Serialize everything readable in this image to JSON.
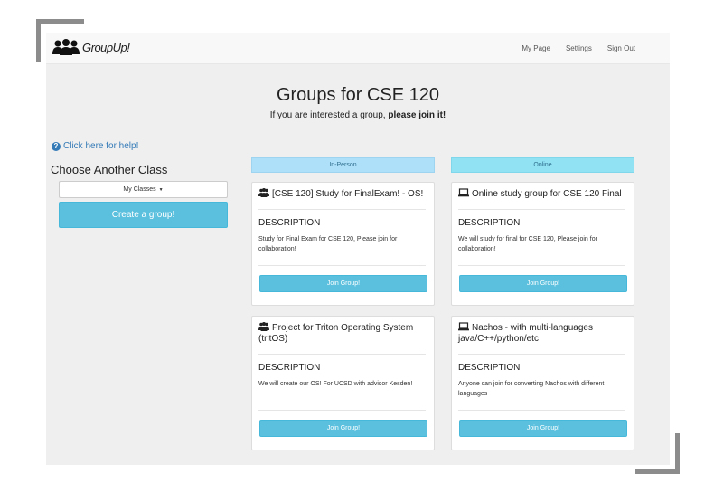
{
  "app": {
    "brand": "GroupUp!"
  },
  "nav": {
    "links": [
      "My Page",
      "Settings",
      "Sign Out"
    ]
  },
  "header": {
    "title": "Groups for CSE 120",
    "subtitle_prefix": "If you are interested a group, ",
    "subtitle_bold": "please join it!"
  },
  "sidebar": {
    "help_text": "Click here for help!",
    "choose_title": "Choose Another Class",
    "classes_dropdown": "My Classes",
    "create_button": "Create a group!"
  },
  "columns": {
    "in_person": "In-Person",
    "online": "Online"
  },
  "desc_label": "DESCRIPTION",
  "join_label": "Join Group!",
  "groups": {
    "in_person": [
      {
        "icon": "users-icon",
        "title": "[CSE 120] Study for FinalExam! - OS!",
        "description": "Study for Final Exam for CSE 120, Please join for collaboration!"
      },
      {
        "icon": "users-icon",
        "title": "Project for Triton Operating System (tritOS)",
        "description": "We will create our OS! For UCSD with advisor Kesden!"
      }
    ],
    "online": [
      {
        "icon": "laptop-icon",
        "title": "Online study group for CSE 120 Final",
        "description": "We will study for final for CSE 120, Please join for collaboration!"
      },
      {
        "icon": "laptop-icon",
        "title": "Nachos - with multi-languages java/C++/python/etc",
        "description": "Anyone can join for converting Nachos with different languages"
      }
    ]
  },
  "colors": {
    "info": "#5bc0de",
    "link": "#337ab7",
    "in_person_header": "#aee0fa",
    "online_header": "#91e3f4"
  }
}
